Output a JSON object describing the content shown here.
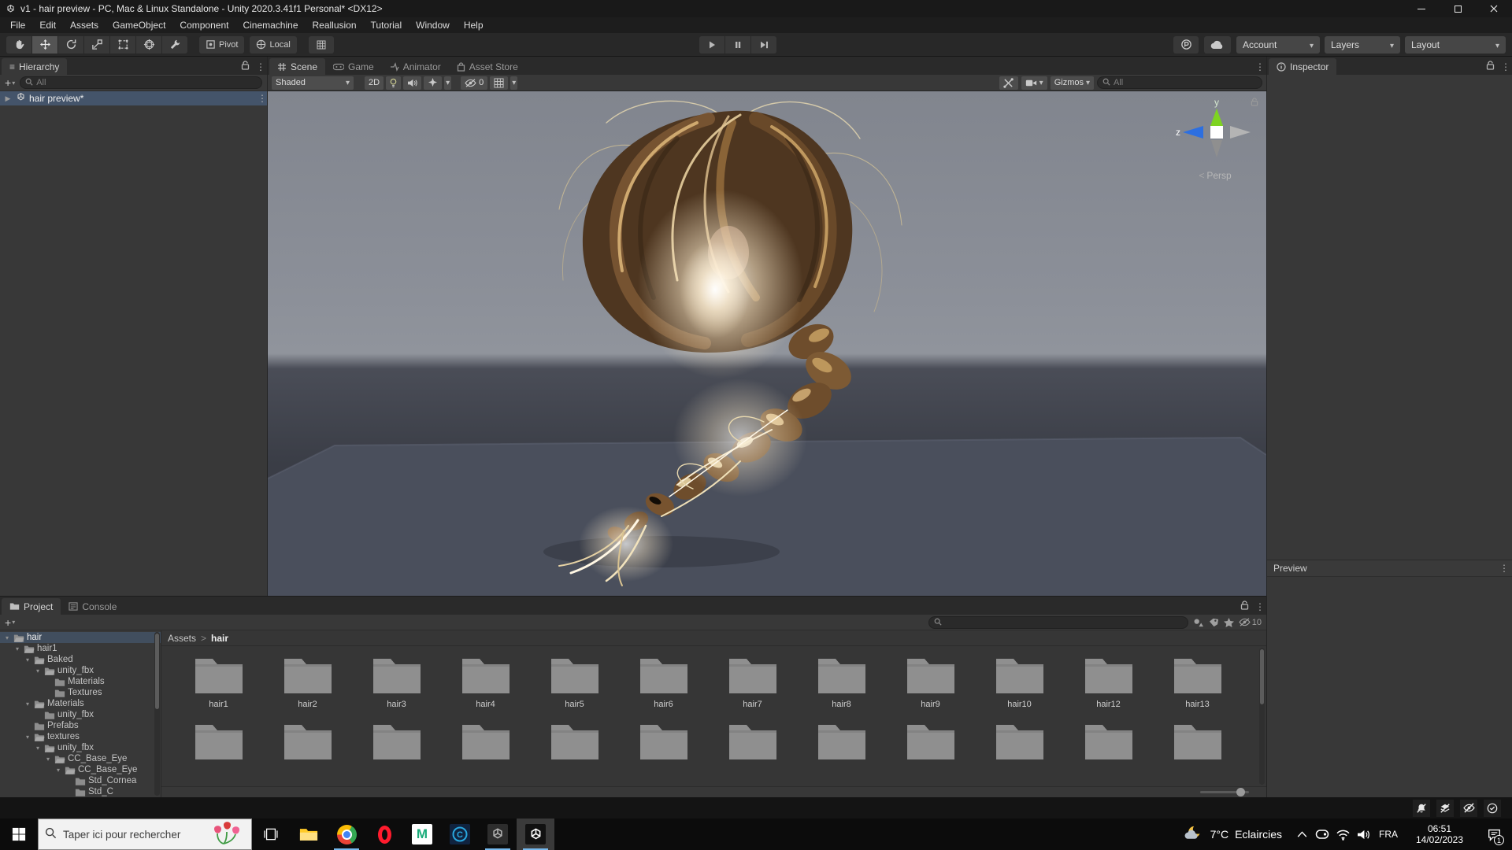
{
  "window": {
    "title": "v1 - hair preview - PC, Mac & Linux Standalone - Unity 2020.3.41f1 Personal* <DX12>",
    "menus": [
      "File",
      "Edit",
      "Assets",
      "GameObject",
      "Component",
      "Cinemachine",
      "Reallusion",
      "Tutorial",
      "Window",
      "Help"
    ]
  },
  "toolbar": {
    "pivot": "Pivot",
    "local": "Local",
    "account": "Account",
    "layers": "Layers",
    "layout": "Layout"
  },
  "hierarchy": {
    "tab": "Hierarchy",
    "search_placeholder": "All",
    "scene_item": "hair preview*"
  },
  "scene": {
    "tabs": [
      "Scene",
      "Game",
      "Animator",
      "Asset Store"
    ],
    "shading": "Shaded",
    "mode_2d": "2D",
    "hidden_count": "0",
    "gizmos": "Gizmos",
    "search_placeholder": "All",
    "axis_y": "y",
    "axis_z": "z",
    "projection": "Persp"
  },
  "inspector": {
    "tab": "Inspector",
    "preview": "Preview"
  },
  "project": {
    "tabs": [
      "Project",
      "Console"
    ],
    "breadcrumb_root": "Assets",
    "breadcrumb_sep": ">",
    "breadcrumb_current": "hair",
    "hidden_count": "10",
    "tree": [
      {
        "label": "hair",
        "indent": 0,
        "state": "open",
        "selected": true
      },
      {
        "label": "hair1",
        "indent": 1,
        "state": "open"
      },
      {
        "label": "Baked",
        "indent": 2,
        "state": "open"
      },
      {
        "label": "unity_fbx",
        "indent": 3,
        "state": "open"
      },
      {
        "label": "Materials",
        "indent": 4,
        "state": "leaf"
      },
      {
        "label": "Textures",
        "indent": 4,
        "state": "leaf"
      },
      {
        "label": "Materials",
        "indent": 2,
        "state": "open"
      },
      {
        "label": "unity_fbx",
        "indent": 3,
        "state": "leaf"
      },
      {
        "label": "Prefabs",
        "indent": 2,
        "state": "leaf"
      },
      {
        "label": "textures",
        "indent": 2,
        "state": "open"
      },
      {
        "label": "unity_fbx",
        "indent": 3,
        "state": "open"
      },
      {
        "label": "CC_Base_Eye",
        "indent": 4,
        "state": "open"
      },
      {
        "label": "CC_Base_Eye",
        "indent": 5,
        "state": "open"
      },
      {
        "label": "Std_Cornea",
        "indent": 6,
        "state": "leaf"
      },
      {
        "label": "Std_C",
        "indent": 6,
        "state": "leaf"
      }
    ],
    "folders": [
      "hair1",
      "hair2",
      "hair3",
      "hair4",
      "hair5",
      "hair6",
      "hair7",
      "hair8",
      "hair9",
      "hair10",
      "hair12",
      "hair13"
    ],
    "partial_row_count": 12
  },
  "taskbar": {
    "search_placeholder": "Taper ici pour rechercher",
    "language": "FRA",
    "weather_temp": "7°C",
    "weather_desc": "Eclaircies",
    "time": "06:51",
    "date": "14/02/2023",
    "notification_count": "1"
  },
  "colors": {
    "selection": "#44546a",
    "accent_blue": "#76b9ed"
  }
}
